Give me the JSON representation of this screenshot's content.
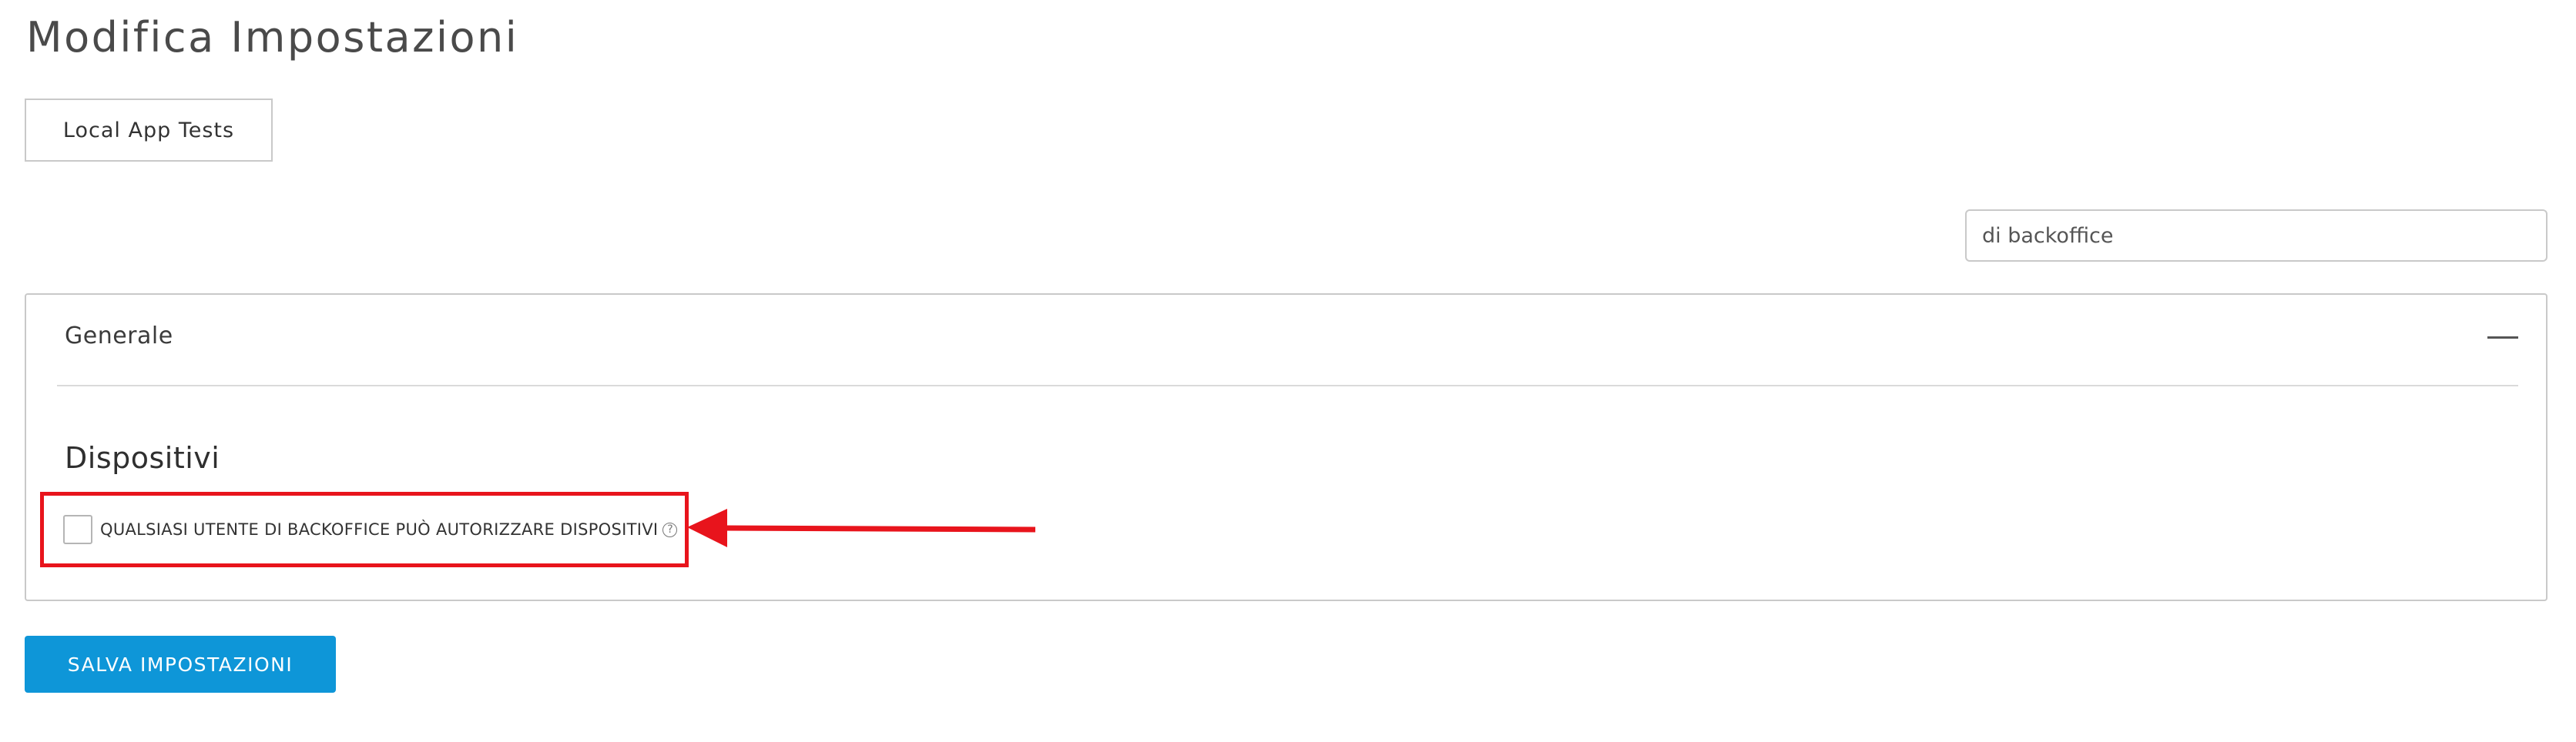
{
  "page": {
    "title": "Modifica Impostazioni"
  },
  "store_tab": {
    "label": "Local App Tests"
  },
  "search": {
    "value": "di backoffice"
  },
  "panel": {
    "title": "Generale",
    "collapse_icon": "minus-icon",
    "section_title": "Dispositivi",
    "option": {
      "label": "QUALSIASI UTENTE DI BACKOFFICE PUÒ AUTORIZZARE DISPOSITIVI",
      "checked": false,
      "help_glyph": "?",
      "help_icon": "question-circle-icon"
    }
  },
  "annotation": {
    "highlight_color": "#e8141c",
    "arrow_icon": "left-arrow-icon"
  },
  "actions": {
    "save_label": "SALVA IMPOSTAZIONI",
    "save_color": "#0e96d8"
  }
}
